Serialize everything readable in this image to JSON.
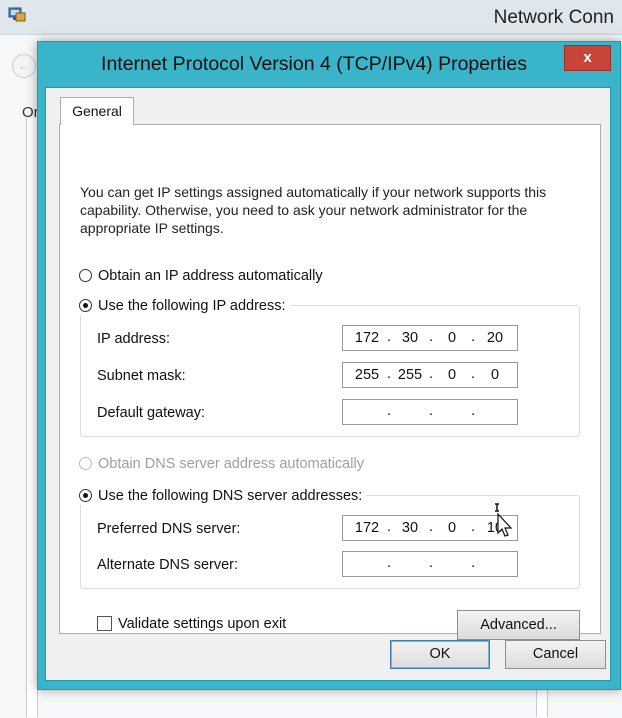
{
  "background_window": {
    "title": "Network Conn",
    "partial_text": "Or"
  },
  "dialog": {
    "title": "Internet Protocol Version 4 (TCP/IPv4) Properties",
    "close_label": "x",
    "tab_general": "General",
    "intro": "You can get IP settings assigned automatically if your network supports this capability. Otherwise, you need to ask your network administrator for the appropriate IP settings.",
    "ip_mode": {
      "auto_label": "Obtain an IP address automatically",
      "manual_label": "Use the following IP address:",
      "selected": "manual"
    },
    "fields": {
      "ip_address": {
        "label": "IP address:",
        "octets": [
          "172",
          "30",
          "0",
          "20"
        ]
      },
      "subnet_mask": {
        "label": "Subnet mask:",
        "octets": [
          "255",
          "255",
          "0",
          "0"
        ]
      },
      "default_gateway": {
        "label": "Default gateway:",
        "octets": [
          "",
          "",
          "",
          ""
        ]
      }
    },
    "dns_mode": {
      "auto_label": "Obtain DNS server address automatically",
      "manual_label": "Use the following DNS server addresses:",
      "selected": "manual"
    },
    "dns_fields": {
      "preferred": {
        "label": "Preferred DNS server:",
        "octets": [
          "172",
          "30",
          "0",
          "10"
        ]
      },
      "alternate": {
        "label": "Alternate DNS server:",
        "octets": [
          "",
          "",
          "",
          ""
        ]
      }
    },
    "validate_label": "Validate settings upon exit",
    "validate_checked": false,
    "advanced_label": "Advanced...",
    "ok_label": "OK",
    "cancel_label": "Cancel"
  },
  "colors": {
    "dialog_frame": "#39b4c8",
    "close_button": "#c7443a"
  }
}
